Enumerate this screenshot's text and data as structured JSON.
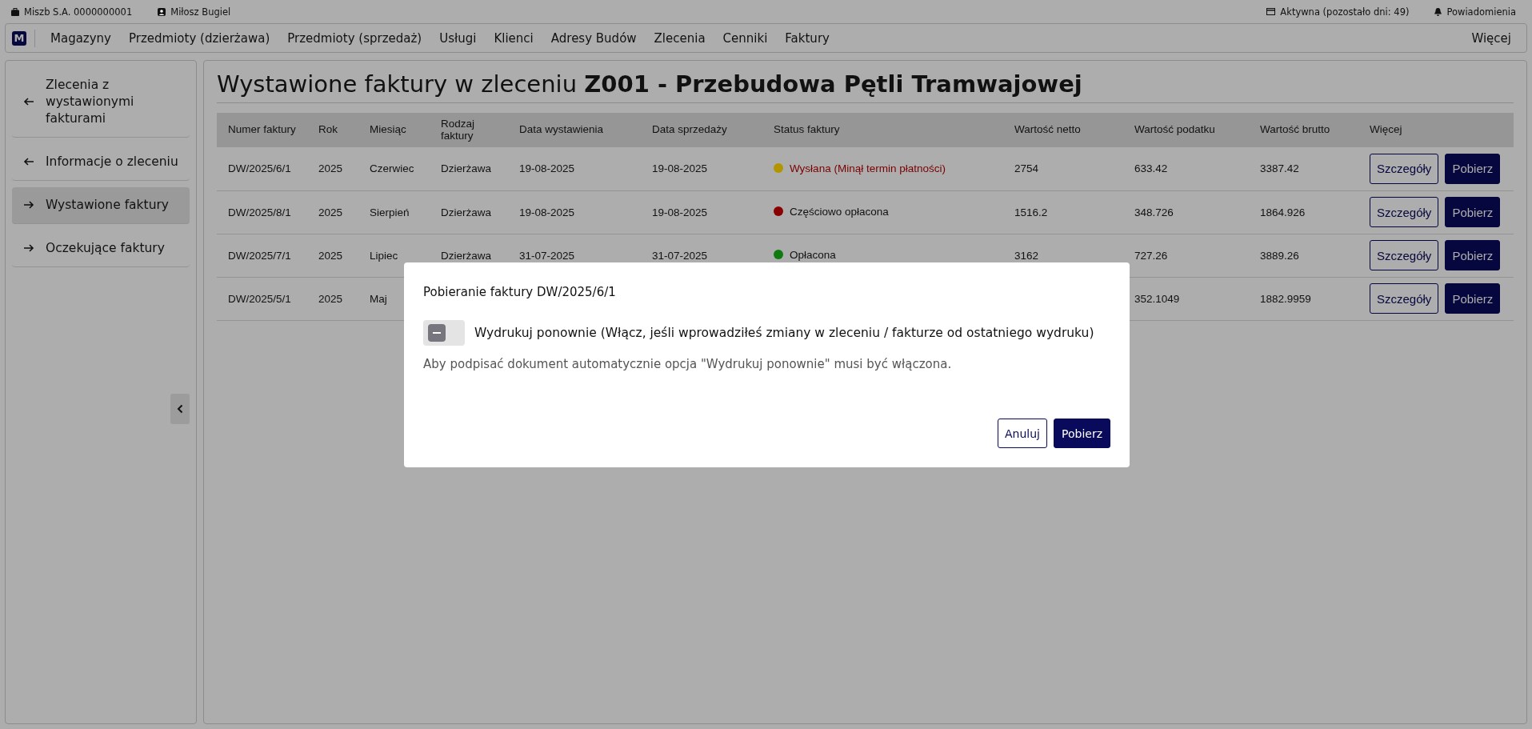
{
  "topbar": {
    "company": "Miszb S.A. 0000000001",
    "user": "Miłosz Bugiel",
    "subscription": "Aktywna (pozostało dni: 49)",
    "notifications": "Powiadomienia"
  },
  "nav": {
    "logo": "M",
    "items": [
      "Magazyny",
      "Przedmioty (dzierżawa)",
      "Przedmioty (sprzedaż)",
      "Usługi",
      "Klienci",
      "Adresy Budów",
      "Zlecenia",
      "Cenniki",
      "Faktury"
    ],
    "more": "Więcej"
  },
  "sidebar": {
    "items": [
      {
        "label": "Zlecenia z wystawionymi fakturami",
        "kind": "back",
        "selected": false
      },
      {
        "label": "Informacje o zleceniu",
        "kind": "back",
        "selected": false
      },
      {
        "label": "Wystawione faktury",
        "kind": "forward",
        "selected": true
      },
      {
        "label": "Oczekujące faktury",
        "kind": "forward",
        "selected": false
      }
    ]
  },
  "title": "Wystawione faktury w zleceniu **Z001 - Przebudowa Pętli Tramwajowej**",
  "table": {
    "columns": [
      "Numer faktury",
      "Rok",
      "Miesiąc",
      "Rodzaj faktury",
      "Data wystawienia",
      "Data sprzedaży",
      "Status faktury",
      "Wartość netto",
      "Wartość podatku",
      "Wartość brutto",
      "Więcej"
    ],
    "rows": [
      {
        "number": "DW/2025/6/1",
        "year": "2025",
        "month": "Czerwiec",
        "type": "Dzierżawa",
        "issued": "19-08-2025",
        "sold": "19-08-2025",
        "status": "Wysłana (Minął termin płatności)",
        "color": "#b39500",
        "overdue": true,
        "net": "2754",
        "tax": "633.42",
        "gross": "3387.42",
        "details": "Szczegóły",
        "download": "Pobierz"
      },
      {
        "number": "DW/2025/8/1",
        "year": "2025",
        "month": "Sierpień",
        "type": "Dzierżawa",
        "issued": "19-08-2025",
        "sold": "19-08-2025",
        "status": "Częściowo opłacona",
        "color": "#8a0000",
        "overdue": false,
        "net": "1516.2",
        "tax": "348.726",
        "gross": "1864.926",
        "details": "Szczegóły",
        "download": "Pobierz"
      },
      {
        "number": "DW/2025/7/1",
        "year": "2025",
        "month": "Lipiec",
        "type": "Dzierżawa",
        "issued": "31-07-2025",
        "sold": "31-07-2025",
        "status": "Opłacona",
        "color": "#0f7a0f",
        "overdue": false,
        "net": "3162",
        "tax": "727.26",
        "gross": "3889.26",
        "details": "Szczegóły",
        "download": "Pobierz"
      },
      {
        "number": "DW/2025/5/1",
        "year": "2025",
        "month": "Maj",
        "tax": "352.1049",
        "gross": "1882.9959",
        "details": "Szczegóły",
        "download": "Pobierz"
      }
    ]
  },
  "dialog": {
    "title": "Pobieranie faktury DW/2025/6/1",
    "reprint": {
      "label": "Wydrukuj ponownie (Włącz, jeśli wprowadziłeś zmiany w zleceniu / fakturze od ostatniego wydruku)",
      "on": false
    },
    "note": "Aby podpisać dokument automatycznie opcja \"Wydrukuj ponownie\" musi być włączona.",
    "cancel": "Anuluj",
    "confirm": "Pobierz"
  }
}
